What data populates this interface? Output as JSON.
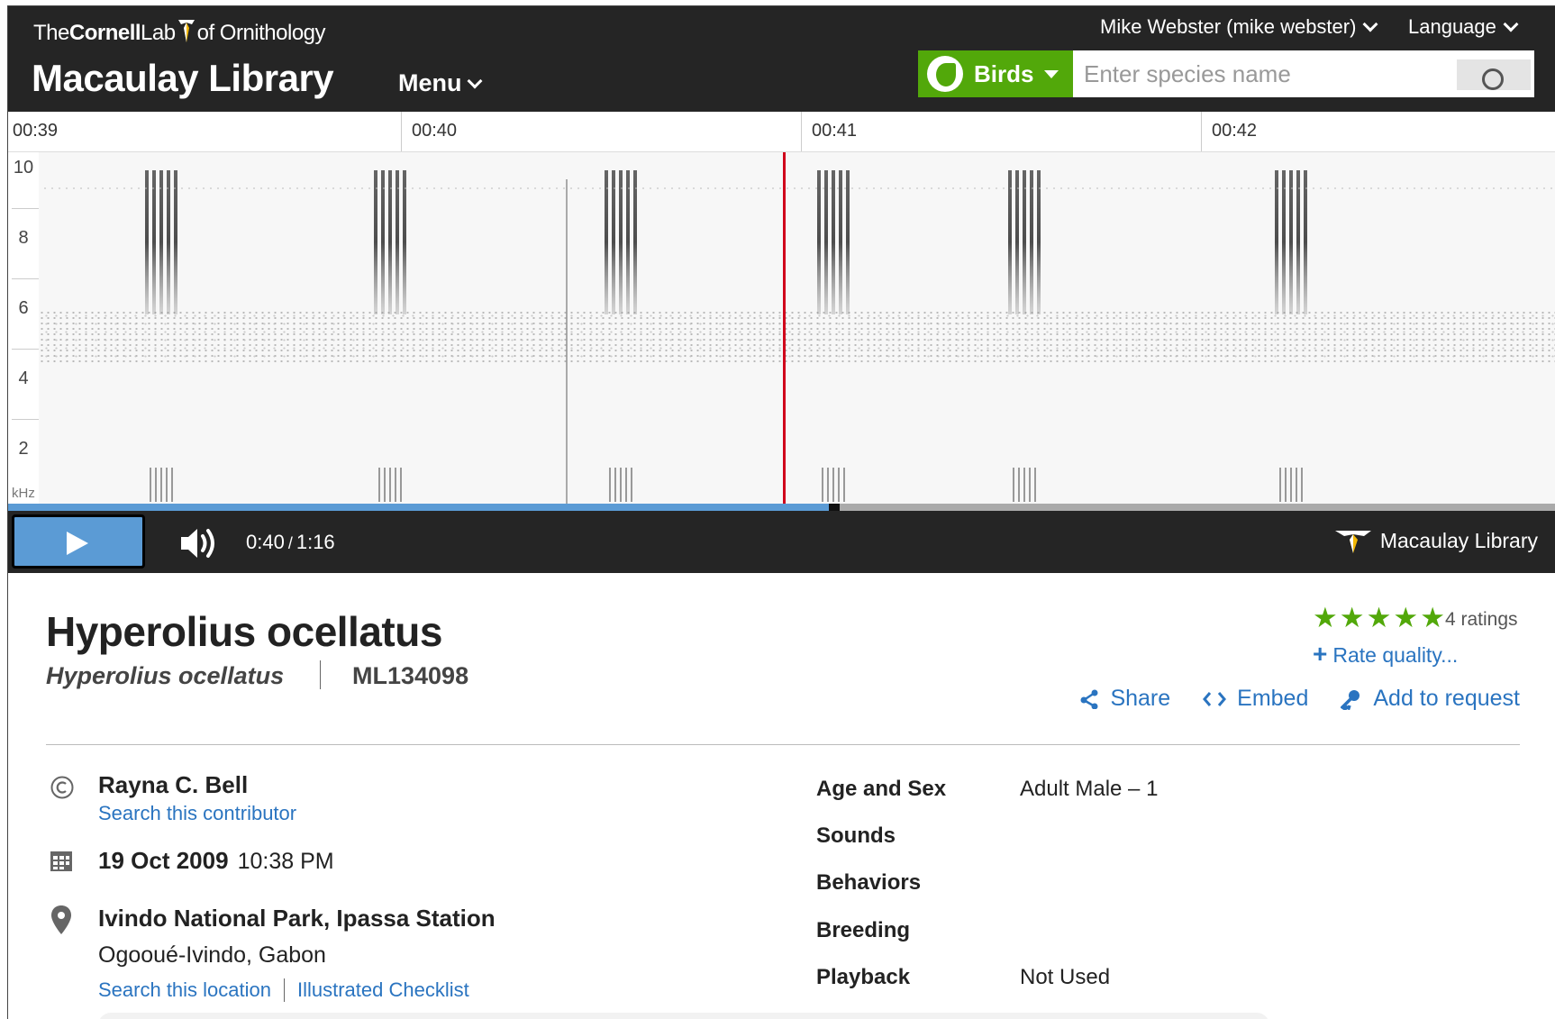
{
  "header": {
    "cornell_logo": {
      "prefix": "The",
      "bold": "Cornell",
      "mid": "Lab",
      "suffix": "of Ornithology"
    },
    "brand": "Macaulay Library",
    "menu_label": "Menu",
    "user_label": "Mike Webster (mike webster)",
    "language_label": "Language",
    "taxon_button": "Birds",
    "search_placeholder": "Enter species name"
  },
  "timeline": {
    "ticks": [
      "00:39",
      "00:40",
      "00:41",
      "00:42"
    ]
  },
  "spectrogram": {
    "y_labels": [
      "10",
      "8",
      "6",
      "4",
      "2"
    ],
    "unit": "kHz",
    "cursor_time": "00:40"
  },
  "player": {
    "current_time": "0:40",
    "separator": "/",
    "duration": "1:16",
    "progress_fraction": 0.53,
    "logo_text": "Macaulay Library"
  },
  "record": {
    "title": "Hyperolius ocellatus",
    "scientific_name": "Hyperolius ocellatus",
    "catalog_id": "ML134098",
    "ratings_text": "4 ratings",
    "stars": 5,
    "rate_link": "Rate quality...",
    "actions": {
      "share": "Share",
      "embed": "Embed",
      "request": "Add to request"
    },
    "contributor": "Rayna C. Bell",
    "contributor_link": "Search this contributor",
    "date": "19 Oct 2009",
    "time": "10:38 PM",
    "location": "Ivindo National Park, Ipassa Station",
    "region": "Ogooué-Ivindo, Gabon",
    "location_link": "Search this location",
    "checklist_link": "Illustrated Checklist"
  },
  "details": [
    {
      "key": "Age and Sex",
      "value": "Adult Male – 1"
    },
    {
      "key": "Sounds",
      "value": ""
    },
    {
      "key": "Behaviors",
      "value": ""
    },
    {
      "key": "Breeding",
      "value": ""
    },
    {
      "key": "Playback",
      "value": "Not Used"
    }
  ],
  "colors": {
    "header_bg": "#252525",
    "accent_green": "#52a80a",
    "link_blue": "#2a74c0",
    "progress_blue": "#5b9bd5",
    "cursor_red": "#d0021b"
  }
}
